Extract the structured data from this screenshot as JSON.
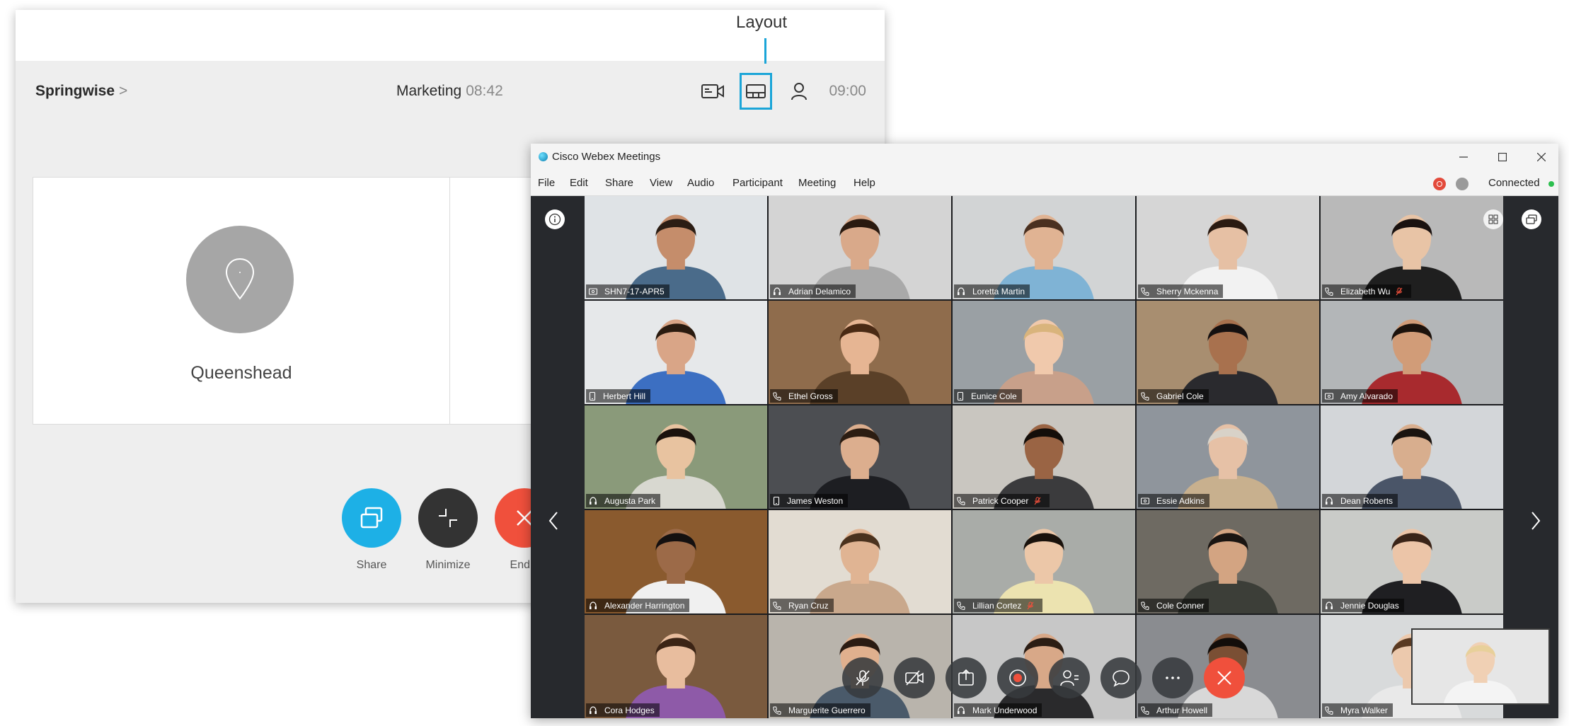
{
  "room": {
    "name": "Springwise",
    "chevron": ">",
    "meeting_title": "Marketing",
    "meeting_time": "08:42",
    "clock": "09:00",
    "tile_label": "Queenshead",
    "buttons": {
      "share": "Share",
      "minimize": "Minimize",
      "end": "End c"
    },
    "colors": {
      "share": "#1db0e6",
      "minimize": "#333333",
      "end": "#f0503c"
    }
  },
  "callout": {
    "label": "Layout",
    "color": "#1ba5d8"
  },
  "webex": {
    "title": "Cisco Webex Meetings",
    "menu": [
      "File",
      "Edit",
      "Share",
      "View",
      "Audio",
      "Participant",
      "Meeting",
      "Help"
    ],
    "status": "Connected",
    "window_buttons": [
      "minimize-icon",
      "maximize-icon",
      "close-icon"
    ]
  },
  "participants": [
    {
      "name": "SHN7-17-APR5",
      "device": "room",
      "bg": "#dfe3e6",
      "skin": "#c58d6b",
      "shirt": "#4a6b8a",
      "hair": "#2b1d14"
    },
    {
      "name": "Adrian Delamico",
      "device": "headset",
      "bg": "#d4d4d4",
      "skin": "#d9a98a",
      "shirt": "#a9a9a9",
      "hair": "#2a1a10",
      "active": true
    },
    {
      "name": "Loretta Martin",
      "device": "headset",
      "bg": "#d2d4d5",
      "skin": "#e0b393",
      "shirt": "#7fb3d5",
      "hair": "#4a3020"
    },
    {
      "name": "Sherry Mckenna",
      "device": "phone",
      "bg": "#d6d6d6",
      "skin": "#e6c0a4",
      "shirt": "#f2f2f2",
      "hair": "#2b1b12"
    },
    {
      "name": "Elizabeth Wu",
      "device": "phone",
      "bg": "#b9b9b9",
      "skin": "#e8c4a6",
      "shirt": "#1f1f1f",
      "hair": "#1a1210",
      "muted": true
    },
    {
      "name": "Herbert Hill",
      "device": "mobile",
      "bg": "#e6e8ea",
      "skin": "#d9a587",
      "shirt": "#3c6fc2",
      "hair": "#2a1b10"
    },
    {
      "name": "Ethel Gross",
      "device": "phone",
      "bg": "#8f6c4c",
      "skin": "#e6b593",
      "shirt": "#5a4028",
      "hair": "#4a2a14"
    },
    {
      "name": "Eunice Cole",
      "device": "mobile",
      "bg": "#9aa0a4",
      "skin": "#f0c9ac",
      "shirt": "#c8a08a",
      "hair": "#d9b47c"
    },
    {
      "name": "Gabriel Cole",
      "device": "phone",
      "bg": "#a88e70",
      "skin": "#a8714e",
      "shirt": "#2a2a2e",
      "hair": "#151010"
    },
    {
      "name": "Amy Alvarado",
      "device": "room",
      "bg": "#b3b6b8",
      "skin": "#d19c78",
      "shirt": "#a82a2e",
      "hair": "#1c120c"
    },
    {
      "name": "Augusta Park",
      "device": "headset",
      "bg": "#8a9a7a",
      "skin": "#e8c3a0",
      "shirt": "#d8d8d0",
      "hair": "#1b120d"
    },
    {
      "name": "James Weston",
      "device": "mobile",
      "bg": "#4c4e52",
      "skin": "#dcae8e",
      "shirt": "#1d1e22",
      "hair": "#2c1d12"
    },
    {
      "name": "Patrick Cooper",
      "device": "phone",
      "bg": "#c9c6c0",
      "skin": "#9a6444",
      "shirt": "#3b3b3d",
      "hair": "#140e0a",
      "muted": true
    },
    {
      "name": "Essie Adkins",
      "device": "room",
      "bg": "#8f959c",
      "skin": "#e6c1a6",
      "shirt": "#c8b08e",
      "hair": "#d8d2c8"
    },
    {
      "name": "Dean Roberts",
      "device": "headset",
      "bg": "#d3d6d9",
      "skin": "#d8ae8e",
      "shirt": "#4a5568",
      "hair": "#1a1410"
    },
    {
      "name": "Alexander Harrington",
      "device": "headset",
      "bg": "#8a5a2e",
      "skin": "#9c6a48",
      "shirt": "#f0f0f0",
      "hair": "#141010"
    },
    {
      "name": "Ryan Cruz",
      "device": "phone",
      "bg": "#e2dcd2",
      "skin": "#e0b493",
      "shirt": "#c9a88c",
      "hair": "#4a321e"
    },
    {
      "name": "Lillian Cortez",
      "device": "phone",
      "bg": "#a9aca8",
      "skin": "#ecc7a8",
      "shirt": "#ece3b0",
      "hair": "#1a120c",
      "muted": true
    },
    {
      "name": "Cole Conner",
      "device": "phone",
      "bg": "#6e6a62",
      "skin": "#d3a482",
      "shirt": "#3c3e38",
      "hair": "#1a1512"
    },
    {
      "name": "Jennie Douglas",
      "device": "headset",
      "bg": "#c9cbc8",
      "skin": "#ecc5a8",
      "shirt": "#1f1f22",
      "hair": "#3a2418"
    },
    {
      "name": "Cora Hodges",
      "device": "headset",
      "bg": "#7a5a3e",
      "skin": "#e8bd9e",
      "shirt": "#8e5aa8",
      "hair": "#3b2415"
    },
    {
      "name": "Marguerite Guerrero",
      "device": "phone",
      "bg": "#b9b4ac",
      "skin": "#e0b08e",
      "shirt": "#4a5a6a",
      "hair": "#2a1b12"
    },
    {
      "name": "Mark Underwood",
      "device": "headset",
      "bg": "#c7c7c7",
      "skin": "#d8a888",
      "shirt": "#2a2a2c",
      "hair": "#2b1d14"
    },
    {
      "name": "Arthur Howell",
      "device": "phone",
      "bg": "#8a8c90",
      "skin": "#7a4f34",
      "shirt": "#d8d8d8",
      "hair": "#120d0a"
    },
    {
      "name": "Myra Walker",
      "device": "phone",
      "bg": "#d8dadb",
      "skin": "#ecc9ad",
      "shirt": "#e9e9e9",
      "hair": "#5a3a22"
    }
  ],
  "self_view": {
    "bg": "#e6e6e6",
    "skin": "#f0d0b4",
    "shirt": "#f4f4f4",
    "hair": "#e8d09a"
  },
  "controls": [
    "mute-icon",
    "video-icon",
    "share-icon",
    "record-icon",
    "participants-icon",
    "chat-icon",
    "more-icon",
    "end-call-icon"
  ]
}
